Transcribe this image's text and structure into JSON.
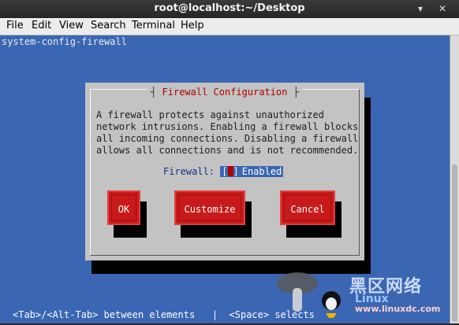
{
  "window": {
    "title": "root@localhost:~/Desktop",
    "minimize_icon": "minimize-icon",
    "close_icon": "close-icon"
  },
  "menu": {
    "items": [
      "File",
      "Edit",
      "View",
      "Search",
      "Terminal",
      "Help"
    ]
  },
  "terminal": {
    "command": "system-config-firewall"
  },
  "dialog": {
    "title": "Firewall Configuration",
    "message": "A firewall protects against unauthorized\nnetwork intrusions. Enabling a firewall blocks\nall incoming connections. Disabling a firewall\nallows all connections and is not recommended.",
    "firewall_label": "Firewall:",
    "checkbox_open": "[",
    "checkbox_close": "]",
    "checkbox_state": "Enabled",
    "buttons": {
      "ok": "OK",
      "customize": "Customize",
      "cancel": "Cancel"
    }
  },
  "status_bar": "<Tab>/<Alt-Tab> between elements   |  <Space> selects",
  "watermark": {
    "chinese": "黑区网络",
    "english": "Linux",
    "site": "www.linuxdc.com"
  },
  "colors": {
    "terminal_bg": "#3b66b3",
    "dialog_bg": "#c3c3c3",
    "button": "#c81a1a",
    "title_text": "#b00000"
  }
}
